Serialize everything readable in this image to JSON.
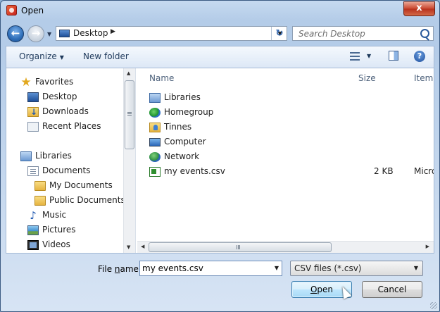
{
  "window": {
    "title": "Open",
    "close_glyph": "x"
  },
  "address": {
    "back_glyph": "←",
    "forward_glyph": "→",
    "location": "Desktop",
    "separator": "▶",
    "dropdown_glyph": "▼",
    "refresh_glyph": "↻"
  },
  "search": {
    "placeholder": "Search Desktop"
  },
  "toolbar": {
    "organize_label": "Organize",
    "caret": "▼",
    "new_folder_label": "New folder",
    "help_glyph": "?"
  },
  "nav": {
    "favorites_label": "Favorites",
    "favorites": [
      "Desktop",
      "Downloads",
      "Recent Places"
    ],
    "libraries_label": "Libraries",
    "libraries": [
      "Documents",
      "My Documents",
      "Public Documents",
      "Music",
      "Pictures",
      "Videos"
    ]
  },
  "columns": {
    "name": "Name",
    "size": "Size",
    "type": "Item t"
  },
  "files": [
    {
      "name": "Libraries",
      "icon": "libraries-icon",
      "size": "",
      "type": ""
    },
    {
      "name": "Homegroup",
      "icon": "homegroup-icon",
      "size": "",
      "type": ""
    },
    {
      "name": "Tinnes",
      "icon": "user-folder-icon",
      "size": "",
      "type": ""
    },
    {
      "name": "Computer",
      "icon": "computer-icon",
      "size": "",
      "type": ""
    },
    {
      "name": "Network",
      "icon": "network-icon",
      "size": "",
      "type": ""
    },
    {
      "name": "my events.csv",
      "icon": "csv-file-icon",
      "size": "2 KB",
      "type": "Micro"
    }
  ],
  "scroll_glyphs": {
    "up": "▲",
    "down": "▼",
    "left": "◀",
    "right": "▶"
  },
  "bottom": {
    "file_name_label_pre": "File ",
    "file_name_label_u": "n",
    "file_name_label_post": "ame:",
    "file_name_value": "my events.csv",
    "dropdown_glyph": "▼",
    "file_type": "CSV files (*.csv)",
    "open_label_u": "O",
    "open_label_rest": "pen",
    "cancel_label": "Cancel"
  },
  "colors": {
    "titlebar": "#b4cce8",
    "accent": "#2d6db8",
    "close": "#c9452d"
  }
}
